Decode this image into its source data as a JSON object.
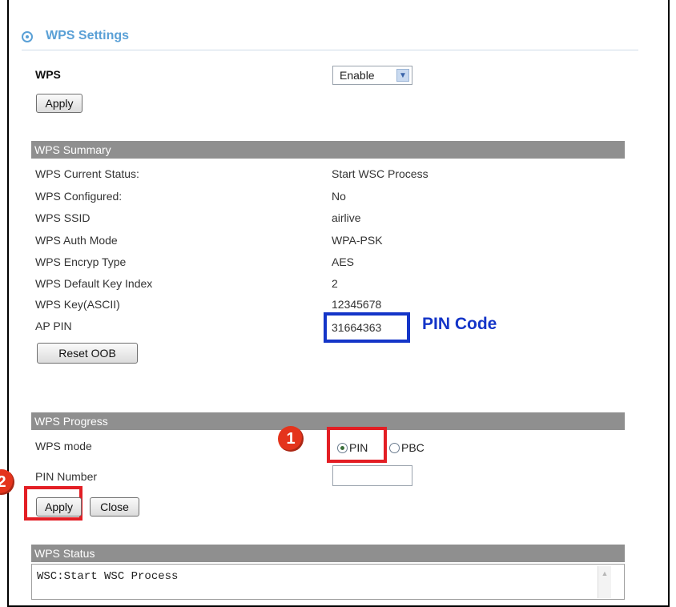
{
  "title": "WPS Settings",
  "wps": {
    "label": "WPS",
    "select_value": "Enable",
    "apply_label": "Apply"
  },
  "summary": {
    "header": "WPS Summary",
    "rows": [
      {
        "label": "WPS Current Status:",
        "value": "Start WSC Process"
      },
      {
        "label": "WPS Configured:",
        "value": "No"
      },
      {
        "label": "WPS SSID",
        "value": "airlive"
      },
      {
        "label": "WPS Auth Mode",
        "value": "WPA-PSK"
      },
      {
        "label": "WPS Encryp Type",
        "value": "AES"
      },
      {
        "label": "WPS Default Key Index",
        "value": "2"
      },
      {
        "label": "WPS Key(ASCII)",
        "value": "12345678"
      },
      {
        "label": "AP PIN",
        "value": "31664363"
      }
    ],
    "reset_label": "Reset OOB",
    "pin_code_annotation": "PIN Code"
  },
  "progress": {
    "header": "WPS Progress",
    "mode_label": "WPS mode",
    "mode_options": [
      "PIN",
      "PBC"
    ],
    "mode_selected": "PIN",
    "pin_number_label": "PIN Number",
    "pin_number_value": "",
    "apply_label": "Apply",
    "close_label": "Close"
  },
  "annotations": {
    "badge1": "1",
    "badge2": "2"
  },
  "status": {
    "header": "WPS Status",
    "text": "WSC:Start WSC Process"
  },
  "colors": {
    "accent": "#5aa0d6",
    "section_bar": "#8f8f8f",
    "highlight_red": "#e31e24",
    "highlight_blue": "#1435c8"
  }
}
